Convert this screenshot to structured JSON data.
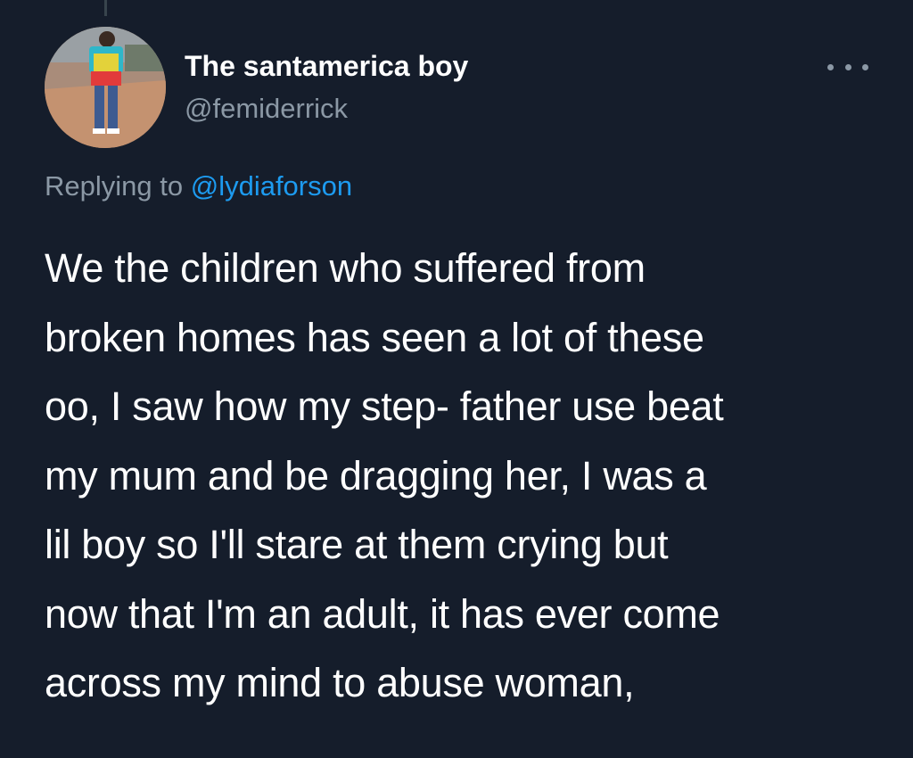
{
  "author": {
    "display_name": "The santamerica boy",
    "handle": "@femiderrick"
  },
  "reply": {
    "prefix": "Replying to ",
    "mention": "@lydiaforson"
  },
  "tweet": {
    "lines": [
      "We the children who suffered from",
      "broken homes has seen a lot of these",
      "oo, I saw how my step- father use beat",
      "my mum and be dragging her, I was a",
      "lil boy so I'll stare at them crying but",
      "now that I'm an adult, it has ever come",
      "across my mind to abuse woman,"
    ]
  },
  "icons": {
    "more": "more-options-icon"
  },
  "colors": {
    "background": "#151d2b",
    "text_primary": "#ffffff",
    "text_secondary": "#8b98a5",
    "link": "#1d9bf0"
  }
}
